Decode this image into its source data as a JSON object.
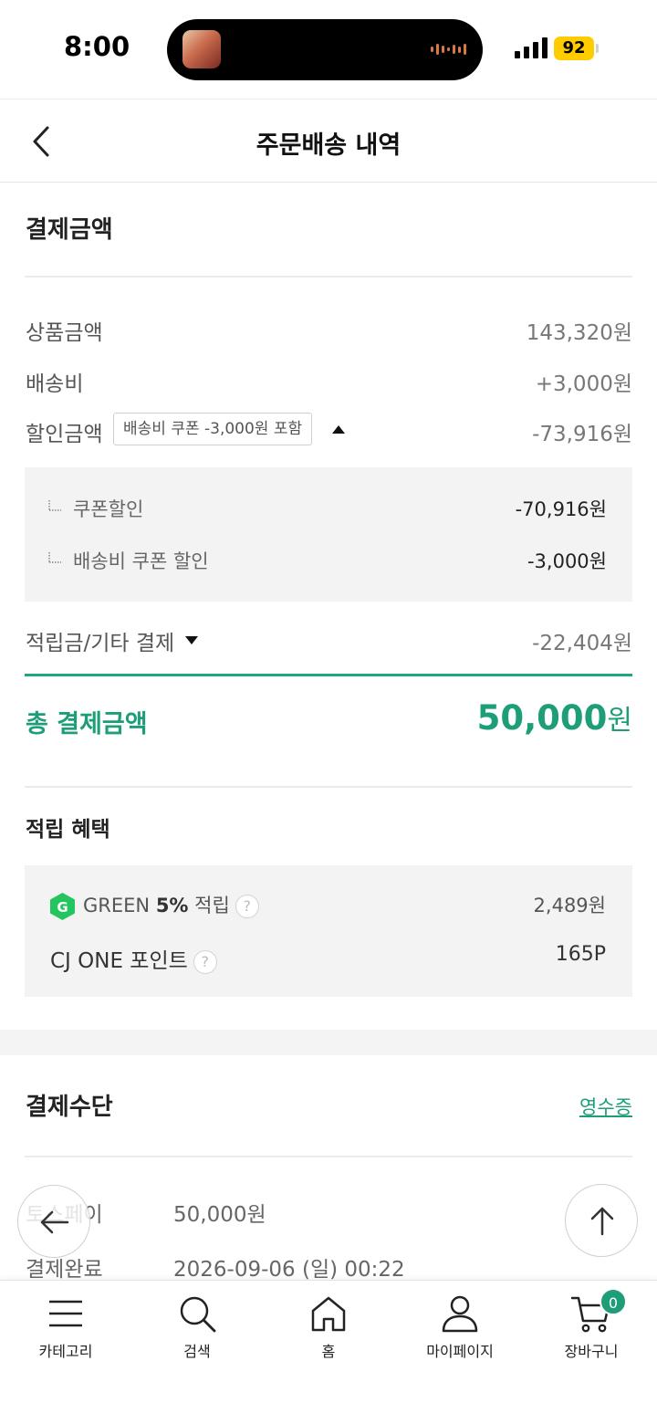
{
  "status_bar": {
    "time": "8:00",
    "battery": "92"
  },
  "header": {
    "title": "주문배송 내역"
  },
  "payment_amount": {
    "title": "결제금액",
    "product_label": "상품금액",
    "product_value": "143,320원",
    "shipping_label": "배송비",
    "shipping_value": "+3,000원",
    "discount_label": "할인금액",
    "discount_tag": "배송비 쿠폰 -3,000원 포함",
    "discount_value": "-73,916원",
    "discount_details": [
      {
        "label": "쿠폰할인",
        "value": "-70,916원"
      },
      {
        "label": "배송비 쿠폰 할인",
        "value": "-3,000원"
      }
    ],
    "points_label": "적립금/기타 결제",
    "points_value": "-22,404원",
    "total_label": "총 결제금액",
    "total_number": "50,000",
    "total_unit": "원"
  },
  "benefits": {
    "title": "적립 혜택",
    "green_prefix": "GREEN",
    "green_rate": "5%",
    "green_suffix": "적립",
    "green_value": "2,489원",
    "cjone_label": "CJ ONE 포인트",
    "cjone_value": "165P",
    "help": "?"
  },
  "payment_method": {
    "title": "결제수단",
    "receipt": "영수증",
    "method_label": "토스페이",
    "method_value": "50,000원",
    "status_label": "결제완료",
    "status_value": "2026-09-06 (일) 00:22"
  },
  "bottom_nav": {
    "items": [
      {
        "label": "카테고리",
        "icon": "menu-icon"
      },
      {
        "label": "검색",
        "icon": "search-icon"
      },
      {
        "label": "홈",
        "icon": "home-icon"
      },
      {
        "label": "마이페이지",
        "icon": "user-icon"
      },
      {
        "label": "장바구니",
        "icon": "cart-icon"
      }
    ],
    "cart_count": "0"
  },
  "colors": {
    "accent": "#1d9e79",
    "battery": "#ffcc00"
  }
}
